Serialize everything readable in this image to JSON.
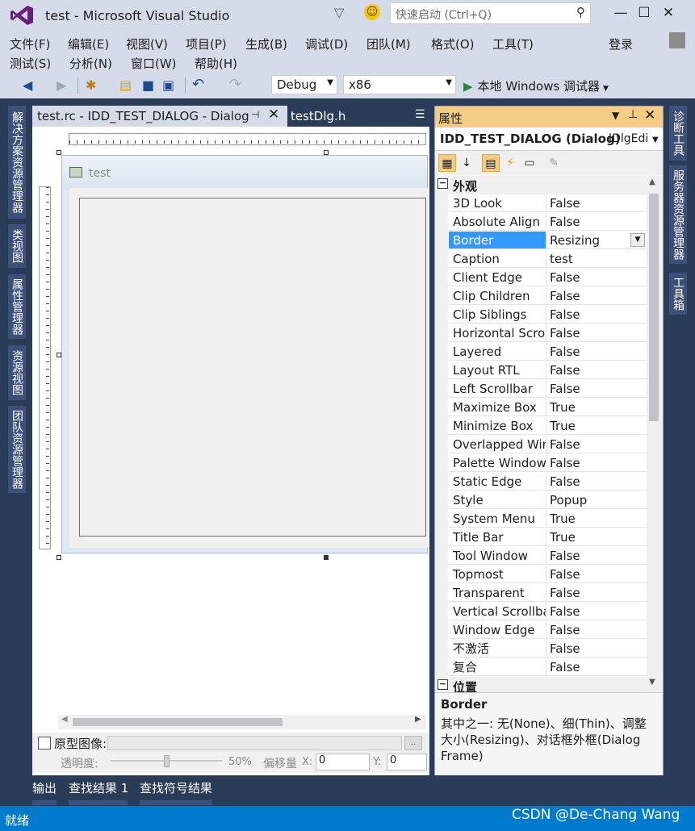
{
  "window": {
    "title": "test - Microsoft Visual Studio",
    "quick_launch_placeholder": "快速启动 (Ctrl+Q)",
    "login": "登录"
  },
  "menu": [
    "文件(F)",
    "编辑(E)",
    "视图(V)",
    "项目(P)",
    "生成(B)",
    "调试(D)",
    "团队(M)",
    "格式(O)",
    "工具(T)",
    "测试(S)",
    "分析(N)",
    "窗口(W)",
    "帮助(H)"
  ],
  "toolbar": {
    "config": "Debug",
    "platform": "x86",
    "run_label": "本地 Windows 调试器"
  },
  "left_tabs": [
    "解决方案资源管理器",
    "类视图",
    "属性管理器",
    "资源视图",
    "团队资源管理器"
  ],
  "right_tabs": [
    "诊断工具",
    "服务器资源管理器",
    "工具箱"
  ],
  "doc_tabs": {
    "active": "test.rc - IDD_TEST_DIALOG - Dialog",
    "inactive": "testDlg.h"
  },
  "dialog": {
    "caption": "test"
  },
  "proto": {
    "label": "原型图像:",
    "browse": "..",
    "opacity_label": "透明度:",
    "opacity_value": "50%",
    "offset_label": "偏移量",
    "x_label": "X:",
    "x_value": "0",
    "y_label": "Y:",
    "y_value": "0"
  },
  "properties": {
    "title": "属性",
    "object_name": "IDD_TEST_DIALOG (Dialog)",
    "object_type": "IDlgEdi",
    "category_appearance": "外观",
    "category_position": "位置",
    "rows": [
      {
        "name": "3D Look",
        "value": "False"
      },
      {
        "name": "Absolute Align",
        "value": "False"
      },
      {
        "name": "Border",
        "value": "Resizing"
      },
      {
        "name": "Caption",
        "value": "test"
      },
      {
        "name": "Client Edge",
        "value": "False"
      },
      {
        "name": "Clip Children",
        "value": "False"
      },
      {
        "name": "Clip Siblings",
        "value": "False"
      },
      {
        "name": "Horizontal Scroll",
        "value": "False"
      },
      {
        "name": "Layered",
        "value": "False"
      },
      {
        "name": "Layout RTL",
        "value": "False"
      },
      {
        "name": "Left Scrollbar",
        "value": "False"
      },
      {
        "name": "Maximize Box",
        "value": "True"
      },
      {
        "name": "Minimize Box",
        "value": "True"
      },
      {
        "name": "Overlapped Window",
        "value": "False"
      },
      {
        "name": "Palette Window",
        "value": "False"
      },
      {
        "name": "Static Edge",
        "value": "False"
      },
      {
        "name": "Style",
        "value": "Popup"
      },
      {
        "name": "System Menu",
        "value": "True"
      },
      {
        "name": "Title Bar",
        "value": "True"
      },
      {
        "name": "Tool Window",
        "value": "False"
      },
      {
        "name": "Topmost",
        "value": "False"
      },
      {
        "name": "Transparent",
        "value": "False"
      },
      {
        "name": "Vertical Scrollbar",
        "value": "False"
      },
      {
        "name": "Window Edge",
        "value": "False"
      },
      {
        "name": "不激活",
        "value": "False"
      },
      {
        "name": "复合",
        "value": "False"
      }
    ],
    "desc_title": "Border",
    "desc_text": "其中之一: 无(None)、细(Thin)、调整大小(Resizing)、对话框外框(Dialog Frame)"
  },
  "bottom_tabs": [
    "输出",
    "查找结果 1",
    "查找符号结果"
  ],
  "status": "就绪",
  "watermark": "CSDN @De-Chang Wang"
}
